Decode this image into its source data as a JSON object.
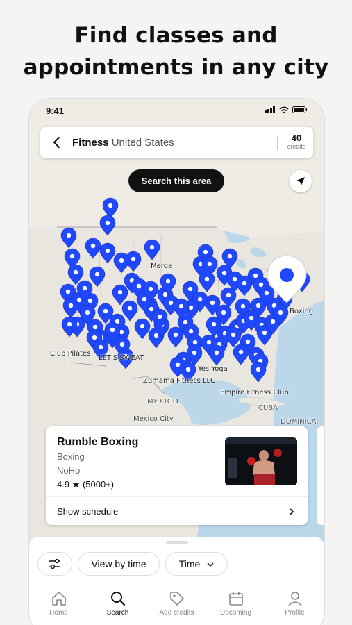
{
  "headline": {
    "line1": "Find classes and",
    "line2": "appointments in any city"
  },
  "status": {
    "time": "9:41"
  },
  "search": {
    "category": "Fitness",
    "location": "United States",
    "credits_value": "40",
    "credits_label": "credits"
  },
  "map": {
    "search_area_label": "Search this area",
    "labels": {
      "merge": "Merge",
      "boxing": "Boxing",
      "club_pilates": "Club Pilates",
      "lets_sweat": "LET'S SWEAT",
      "yes_yoga": "Yes Yoga",
      "zumama": "Zumama Fitness LLC",
      "empire": "Empire Fitness Club",
      "mexico": "MEXICO",
      "mexico_city": "Mexico City",
      "cuba": "CUBA",
      "dominican": "DOMINICAI"
    },
    "pin_color": "#1f48ff",
    "selected_pin_color": "#1f48ff"
  },
  "card": {
    "title": "Rumble Boxing",
    "category": "Boxing",
    "location": "NoHo",
    "rating": "4.9 ★ (5000+)",
    "action": "Show schedule"
  },
  "sheet": {
    "filter_icon": "sliders-icon",
    "view_by_time": "View by time",
    "time": "Time"
  },
  "tabs": [
    {
      "label": "Home",
      "icon": "home-icon"
    },
    {
      "label": "Search",
      "icon": "search-icon"
    },
    {
      "label": "Add credits",
      "icon": "tag-icon"
    },
    {
      "label": "Upcoming",
      "icon": "calendar-icon"
    },
    {
      "label": "Profile",
      "icon": "person-icon"
    }
  ]
}
